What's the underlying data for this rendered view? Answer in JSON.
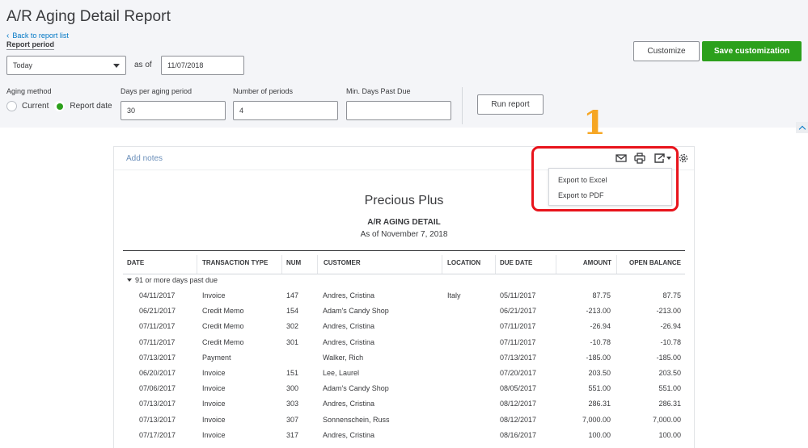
{
  "header": {
    "title": "A/R Aging Detail Report",
    "back_link": "Back to report list",
    "report_period_label": "Report period",
    "period_value": "Today",
    "as_of_label": "as of",
    "as_of_date": "11/07/2018",
    "customize_label": "Customize",
    "save_customization_label": "Save customization"
  },
  "filters": {
    "aging_method_label": "Aging method",
    "current_label": "Current",
    "report_date_label": "Report date",
    "selected_method": "Report date",
    "days_per_period_label": "Days per aging period",
    "days_per_period_value": "30",
    "num_periods_label": "Number of periods",
    "num_periods_value": "4",
    "min_days_label": "Min. Days Past Due",
    "min_days_value": "",
    "run_report_label": "Run report"
  },
  "annotation": {
    "marker_number": "1",
    "highlight_color": "#e8131b",
    "marker_color": "#f6a623"
  },
  "toolbar": {
    "add_notes": "Add notes",
    "icons": [
      "mail-icon",
      "print-icon",
      "export-icon",
      "gear-icon"
    ],
    "export_menu": [
      "Export to Excel",
      "Export to PDF"
    ]
  },
  "report": {
    "company": "Precious Plus",
    "title": "A/R AGING DETAIL",
    "as_of": "As of November 7, 2018",
    "columns": [
      "DATE",
      "TRANSACTION TYPE",
      "NUM",
      "CUSTOMER",
      "LOCATION",
      "DUE DATE",
      "AMOUNT",
      "OPEN BALANCE"
    ],
    "group_label": "91 or more days past due",
    "rows": [
      {
        "date": "04/11/2017",
        "type": "Invoice",
        "num": "147",
        "customer": "Andres, Cristina",
        "location": "Italy",
        "due": "05/11/2017",
        "amount": "87.75",
        "balance": "87.75"
      },
      {
        "date": "06/21/2017",
        "type": "Credit Memo",
        "num": "154",
        "customer": "Adam's Candy Shop",
        "location": "",
        "due": "06/21/2017",
        "amount": "-213.00",
        "balance": "-213.00"
      },
      {
        "date": "07/11/2017",
        "type": "Credit Memo",
        "num": "302",
        "customer": "Andres, Cristina",
        "location": "",
        "due": "07/11/2017",
        "amount": "-26.94",
        "balance": "-26.94"
      },
      {
        "date": "07/11/2017",
        "type": "Credit Memo",
        "num": "301",
        "customer": "Andres, Cristina",
        "location": "",
        "due": "07/11/2017",
        "amount": "-10.78",
        "balance": "-10.78"
      },
      {
        "date": "07/13/2017",
        "type": "Payment",
        "num": "",
        "customer": "Walker, Rich",
        "location": "",
        "due": "07/13/2017",
        "amount": "-185.00",
        "balance": "-185.00"
      },
      {
        "date": "06/20/2017",
        "type": "Invoice",
        "num": "151",
        "customer": "Lee, Laurel",
        "location": "",
        "due": "07/20/2017",
        "amount": "203.50",
        "balance": "203.50"
      },
      {
        "date": "07/06/2017",
        "type": "Invoice",
        "num": "300",
        "customer": "Adam's Candy Shop",
        "location": "",
        "due": "08/05/2017",
        "amount": "551.00",
        "balance": "551.00"
      },
      {
        "date": "07/13/2017",
        "type": "Invoice",
        "num": "303",
        "customer": "Andres, Cristina",
        "location": "",
        "due": "08/12/2017",
        "amount": "286.31",
        "balance": "286.31"
      },
      {
        "date": "07/13/2017",
        "type": "Invoice",
        "num": "307",
        "customer": "Sonnenschein, Russ",
        "location": "",
        "due": "08/12/2017",
        "amount": "7,000.00",
        "balance": "7,000.00"
      },
      {
        "date": "07/17/2017",
        "type": "Invoice",
        "num": "317",
        "customer": "Andres, Cristina",
        "location": "",
        "due": "08/16/2017",
        "amount": "100.00",
        "balance": "100.00"
      }
    ]
  }
}
